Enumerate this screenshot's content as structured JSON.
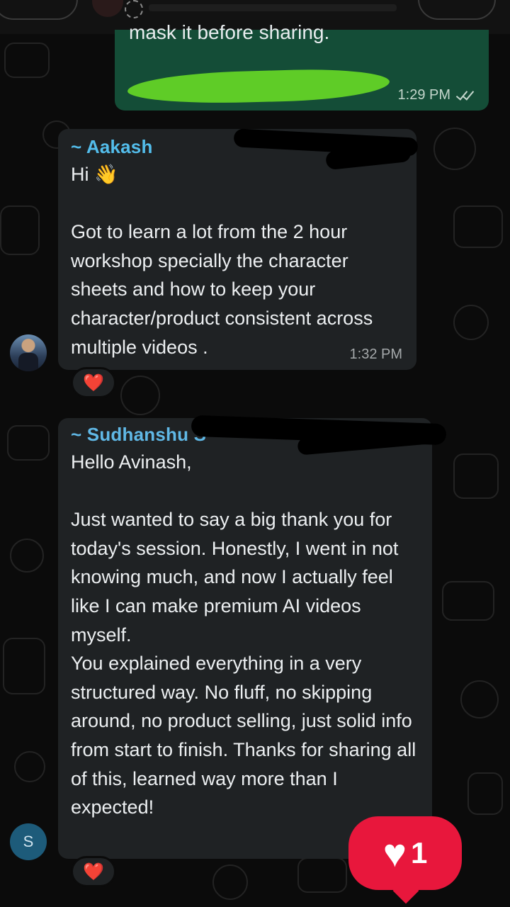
{
  "messages": {
    "outgoing": {
      "partial_text": "mask it before sharing.",
      "time": "1:29 PM"
    },
    "aakash": {
      "sender": "~ Aakash",
      "text": "Hi 👋\n\nGot to learn a lot from the 2 hour workshop specially the character sheets and how to keep your character/product consistent across multiple videos .",
      "time": "1:32 PM",
      "reaction": "❤️"
    },
    "sudhanshu": {
      "sender": "~ Sudhanshu S",
      "avatar_letter": "S",
      "text": "Hello Avinash,\n\nJust wanted to say a big thank you for today's session. Honestly, I went in not knowing much, and now I actually feel like I can make premium AI videos myself.\nYou explained everything in a very structured way. No fluff, no skipping around, no product selling, just solid info from start to finish. Thanks for sharing all of this, learned way more than I expected!",
      "reaction": "❤️"
    }
  },
  "like_badge": {
    "count": "1"
  },
  "colors": {
    "background": "#0b0b0b",
    "incoming_bubble": "#1f2224",
    "outgoing_bubble": "#144d37",
    "sender_name": "#53bdeb",
    "like_badge": "#e8173c",
    "mask": "#5fcc27"
  }
}
